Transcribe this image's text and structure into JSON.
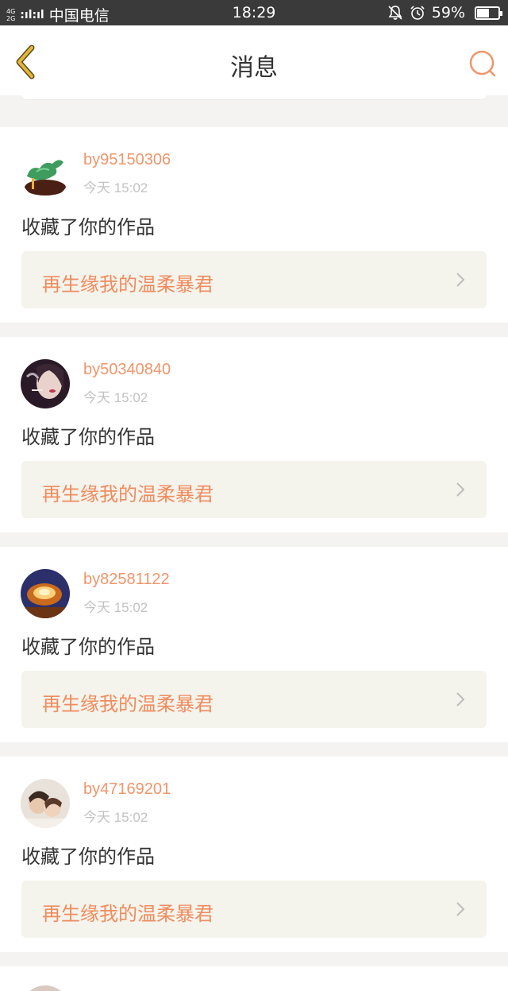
{
  "status_bar": {
    "network_top": "4G",
    "network_bottom": "2G",
    "signal": ":ıl:ıl",
    "carrier": "中国电信",
    "time": "18:29",
    "battery_percent": "59%",
    "battery_level": 0.59
  },
  "navbar": {
    "title": "消息",
    "accent_color": "#f0956a",
    "back_icon_color": "#d6a52a"
  },
  "messages": [
    {
      "username": "by95150306",
      "time": "今天 15:02",
      "action": "收藏了你的作品",
      "work_title": "再生缘我的温柔暴君"
    },
    {
      "username": "by50340840",
      "time": "今天 15:02",
      "action": "收藏了你的作品",
      "work_title": "再生缘我的温柔暴君"
    },
    {
      "username": "by82581122",
      "time": "今天 15:02",
      "action": "收藏了你的作品",
      "work_title": "再生缘我的温柔暴君"
    },
    {
      "username": "by47169201",
      "time": "今天 15:02",
      "action": "收藏了你的作品",
      "work_title": "再生缘我的温柔暴君"
    }
  ]
}
